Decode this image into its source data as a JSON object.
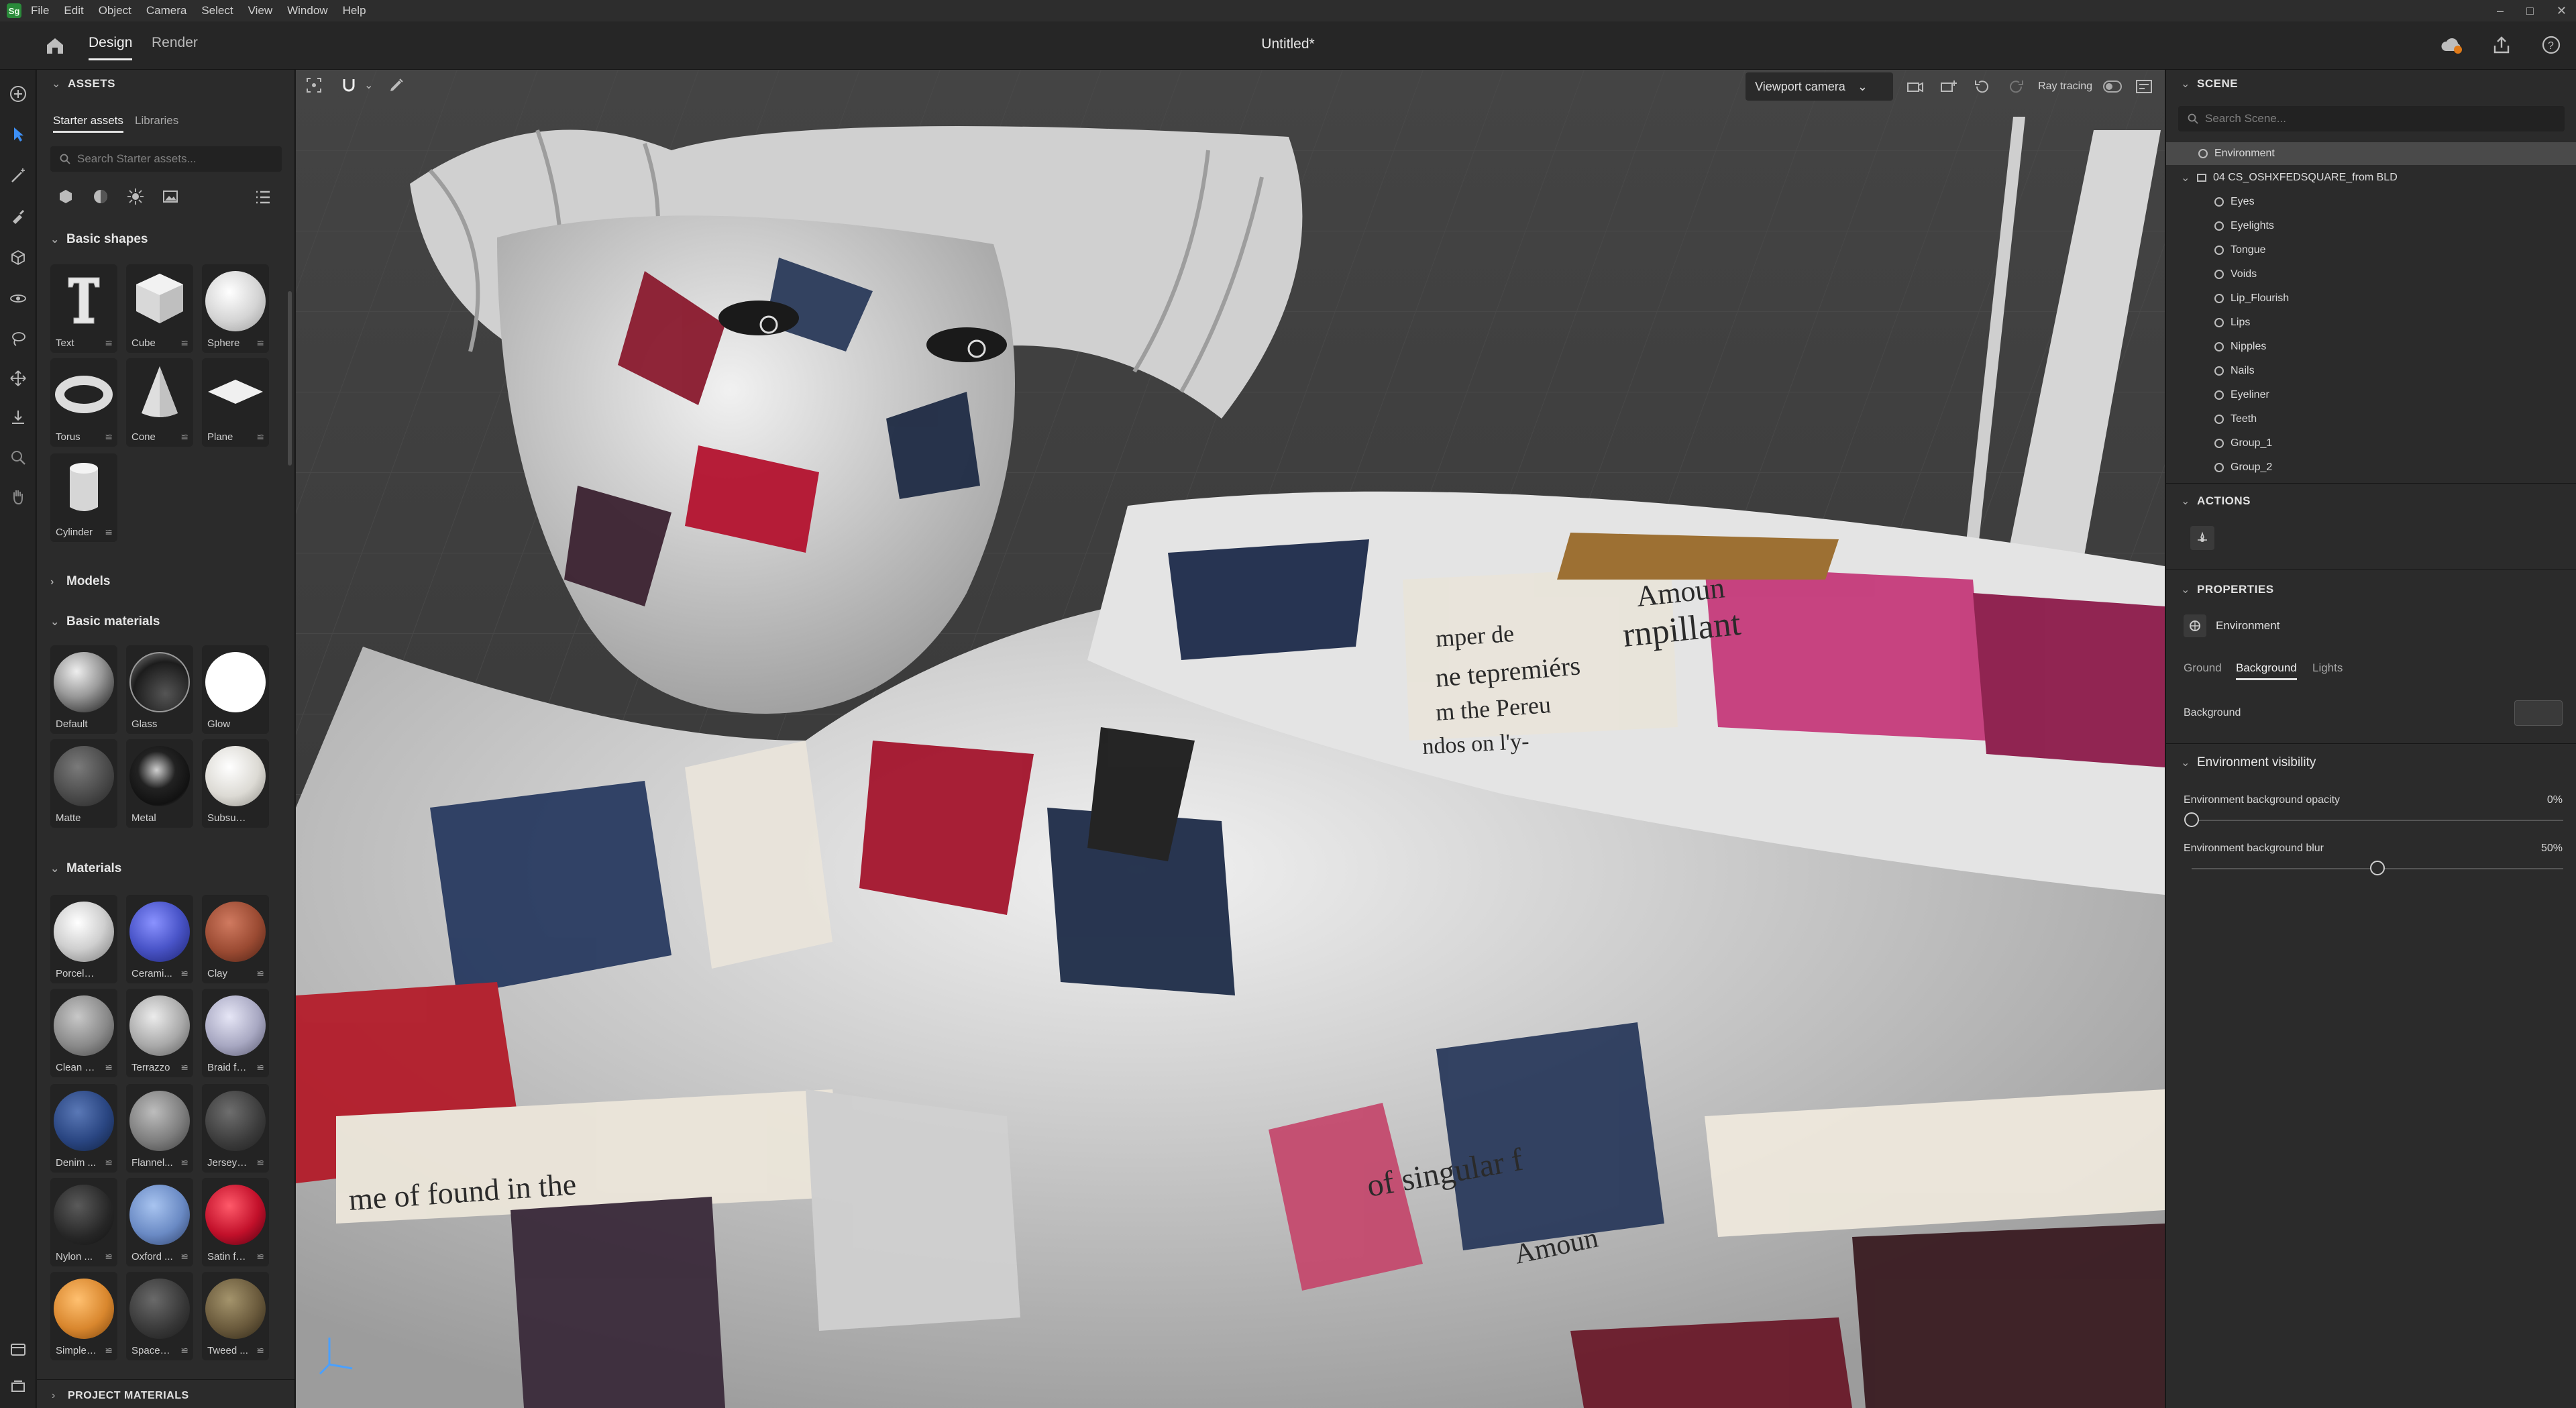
{
  "menubar": {
    "logo_text": "Sg",
    "items": [
      "File",
      "Edit",
      "Object",
      "Camera",
      "Select",
      "View",
      "Window",
      "Help"
    ]
  },
  "tabs": {
    "design": "Design",
    "render": "Render",
    "document_title": "Untitled*"
  },
  "assets": {
    "title": "ASSETS",
    "tabs": [
      "Starter assets",
      "Libraries"
    ],
    "search_placeholder": "Search Starter assets...",
    "basic_shapes": {
      "title": "Basic shapes",
      "items": [
        "Text",
        "Cube",
        "Sphere",
        "Torus",
        "Cone",
        "Plane",
        "Cylinder"
      ]
    },
    "models": {
      "title": "Models"
    },
    "basic_materials": {
      "title": "Basic materials",
      "items": [
        "Default",
        "Glass",
        "Glow",
        "Matte",
        "Metal",
        "Subsurface"
      ]
    },
    "materials": {
      "title": "Materials",
      "items": [
        "Porcelain",
        "Cerami...",
        "Clay",
        "Clean c...",
        "Terrazzo",
        "Braid fa...",
        "Denim ...",
        "Flannel...",
        "Jersey f...",
        "Nylon ...",
        "Oxford ...",
        "Satin fa...",
        "Simple ...",
        "Spacer ...",
        "Tweed ..."
      ]
    },
    "project_materials": "PROJECT MATERIALS"
  },
  "viewport": {
    "camera": "Viewport camera",
    "ray_tracing": "Ray tracing",
    "newsprint": [
      "Amoun",
      "rnpillant",
      "mper de",
      "ne tepremiérs",
      "m the Pereu",
      "ndos on l'y-",
      "of singular f",
      "me of found in the",
      "Amoun"
    ]
  },
  "scene": {
    "title": "SCENE",
    "search_placeholder": "Search Scene...",
    "items": [
      "Environment",
      "04 CS_OSHXFEDSQUARE_from BLD",
      "Eyes",
      "Eyelights",
      "Tongue",
      "Voids",
      "Lip_Flourish",
      "Lips",
      "Nipples",
      "Nails",
      "Eyeliner",
      "Teeth",
      "Group_1",
      "Group_2"
    ]
  },
  "actions": {
    "title": "ACTIONS"
  },
  "properties": {
    "title": "PROPERTIES",
    "object": "Environment",
    "tabs": [
      "Ground",
      "Background",
      "Lights"
    ],
    "background_label": "Background",
    "visibility_title": "Environment visibility",
    "opacity_label": "Environment background opacity",
    "opacity_value": "0%",
    "opacity_level": 0,
    "blur_label": "Environment background blur",
    "blur_value": "50%",
    "blur_level": 0.5
  },
  "colors": {
    "accent": "#e6e6e6",
    "panel": "#2b2b2b",
    "viewport_bg": "#3c3c3c",
    "selected_row": "#4a4a4a",
    "glass_blue": "#4a55c9",
    "clay": "#9a4a32",
    "satin_red": "#c2102a",
    "simple_orange": "#d9872e"
  }
}
